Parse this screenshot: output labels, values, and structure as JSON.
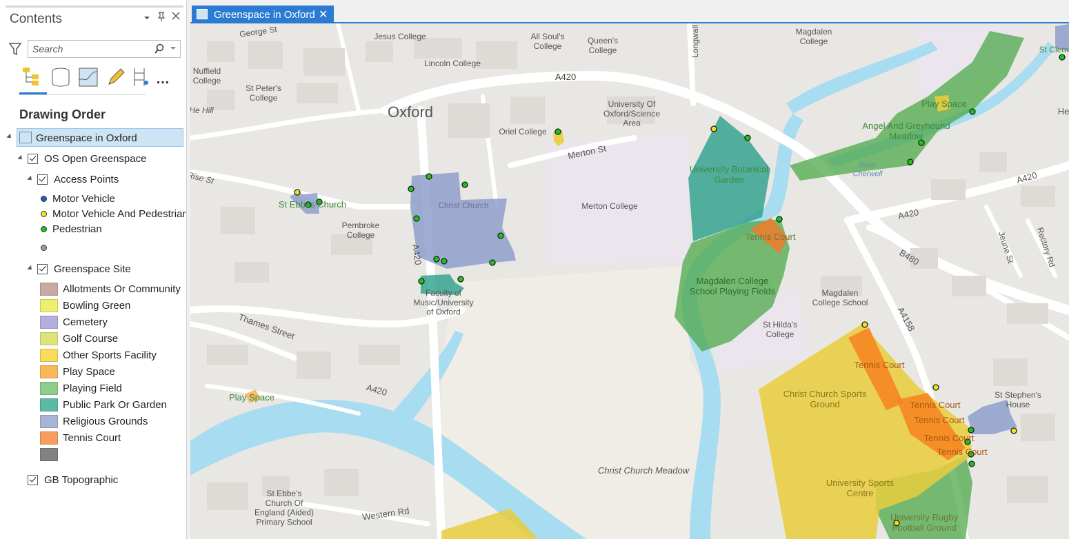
{
  "contents": {
    "title": "Contents",
    "search_placeholder": "Search",
    "drawing_order": "Drawing Order",
    "map_name": "Greenspace in Oxford",
    "group_layer": "OS Open Greenspace",
    "access_points_layer": "Access Points",
    "access_classes": [
      {
        "label": "Motor Vehicle",
        "color": "#1f5fbf"
      },
      {
        "label": "Motor Vehicle And Pedestrian",
        "color": "#f2e21a"
      },
      {
        "label": "Pedestrian",
        "color": "#1cc41c"
      },
      {
        "label": "",
        "color": "#9a9a9a"
      }
    ],
    "greenspace_layer": "Greenspace Site",
    "greenspace_classes": [
      {
        "label": "Allotments Or Community",
        "color": "#c9a9a3"
      },
      {
        "label": "Bowling Green",
        "color": "#eeee70"
      },
      {
        "label": "Cemetery",
        "color": "#b3aedb"
      },
      {
        "label": "Golf Course",
        "color": "#dde47a"
      },
      {
        "label": "Other Sports Facility",
        "color": "#f8dc5a"
      },
      {
        "label": "Play Space",
        "color": "#f7b85a"
      },
      {
        "label": "Playing Field",
        "color": "#8dce8a"
      },
      {
        "label": "Public Park Or Garden",
        "color": "#5cb9a6"
      },
      {
        "label": "Religious Grounds",
        "color": "#a8b4d6"
      },
      {
        "label": "Tennis Court",
        "color": "#f89c5f"
      },
      {
        "label": "",
        "color": "#828282"
      }
    ],
    "basemap_layer": "GB Topographic"
  },
  "tab": {
    "label": "Greenspace in Oxford"
  },
  "map": {
    "place_labels": [
      "George St",
      "Jesus College",
      "All Soul's College",
      "Queen's College",
      "Magdalen College",
      "Longwall",
      "Nuffield College",
      "Lincoln College",
      "St Peter's College",
      "A420",
      "Oxford",
      "University Of Oxford/Science Area",
      "Oriel College",
      "Merton St",
      "He Hill",
      "St Ebbes Church",
      "Christ Church",
      "Merton College",
      "Pembroke College",
      "A420",
      "Faculty of Music/University of Oxford",
      "Thames Street",
      "A420",
      "Christ Church Meadow",
      "St Ebbe's Church Of England (Aided) Primary School",
      "Western Rd",
      "Magdalen College School",
      "St Hilda's College",
      "A4158",
      "B480",
      "A420",
      "A420",
      "Jeune St",
      "Rectory Rd",
      "St Stephen's House",
      "St Clem",
      "He",
      "Rise St"
    ],
    "greenspace_labels": [
      "Play Space",
      "Angel And Greyhound Meadow",
      "University Botanical Garden",
      "Tennis Court",
      "Magdalen College School Playing Fields",
      "Tennis Court",
      "Christ Church Sports Ground",
      "Tennis Court",
      "Tennis Court",
      "Tennis Court",
      "Tennis Court",
      "University Sports Centre",
      "University Rugby Football Ground",
      "Play Space"
    ],
    "water_labels": [
      "River Cherwell"
    ]
  }
}
